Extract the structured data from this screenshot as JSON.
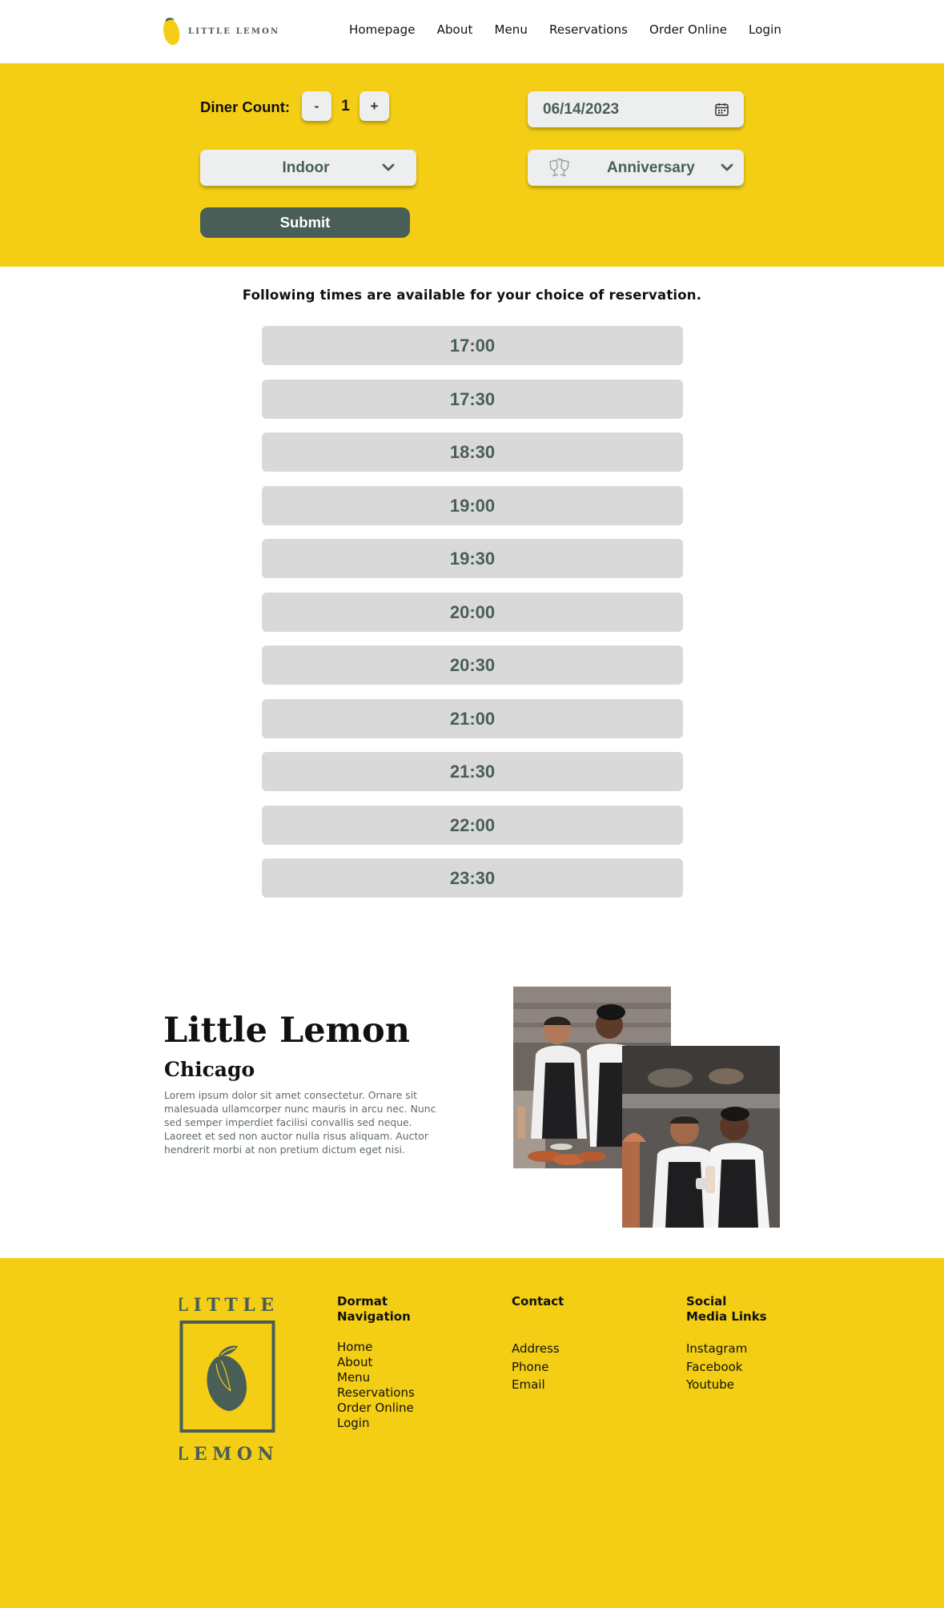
{
  "brand": {
    "logo_text": "LITTLE LEMON",
    "colors": {
      "primary_green": "#495e57",
      "primary_yellow": "#f4ce14",
      "light_gray": "#edefee",
      "slot_gray": "#d9d9d9"
    }
  },
  "nav": {
    "items": [
      {
        "label": "Homepage"
      },
      {
        "label": "About"
      },
      {
        "label": "Menu"
      },
      {
        "label": "Reservations"
      },
      {
        "label": "Order Online"
      },
      {
        "label": "Login"
      }
    ]
  },
  "form": {
    "diner_label": "Diner Count:",
    "minus_label": "-",
    "plus_label": "+",
    "diner_count": "1",
    "date": "06/14/2023",
    "date_icon": "calendar-icon",
    "seating": "Indoor",
    "occasion": "Anniversary",
    "occasion_icon": "champagne-glasses-icon",
    "submit_label": "Submit"
  },
  "times": {
    "heading": "Following times are available for your choice of reservation.",
    "slots": [
      "17:00",
      "17:30",
      "18:30",
      "19:00",
      "19:30",
      "20:00",
      "20:30",
      "21:00",
      "21:30",
      "22:00",
      "23:30"
    ]
  },
  "about": {
    "title": "Little Lemon",
    "subtitle": "Chicago",
    "body": "Lorem ipsum dolor sit amet consectetur. Ornare sit malesuada ullamcorper nunc mauris in arcu nec. Nunc sed semper imperdiet facilisi convallis sed neque. Laoreet et sed non auctor nulla risus aliquam. Auctor hendrerit morbi at non pretium dictum eget nisi."
  },
  "footer": {
    "logo_top": "LITTLE",
    "logo_bottom": "LEMON",
    "nav_heading_1": "Dormat",
    "nav_heading_2": "Navigation",
    "nav_links": [
      "Home",
      "About",
      "Menu",
      "Reservations",
      "Order Online",
      "Login"
    ],
    "contact_heading": "Contact",
    "contact_links": [
      "Address",
      "Phone",
      "Email"
    ],
    "social_heading_1": "Social",
    "social_heading_2": "Media Links",
    "social_links": [
      "Instagram",
      "Facebook",
      "Youtube"
    ]
  }
}
